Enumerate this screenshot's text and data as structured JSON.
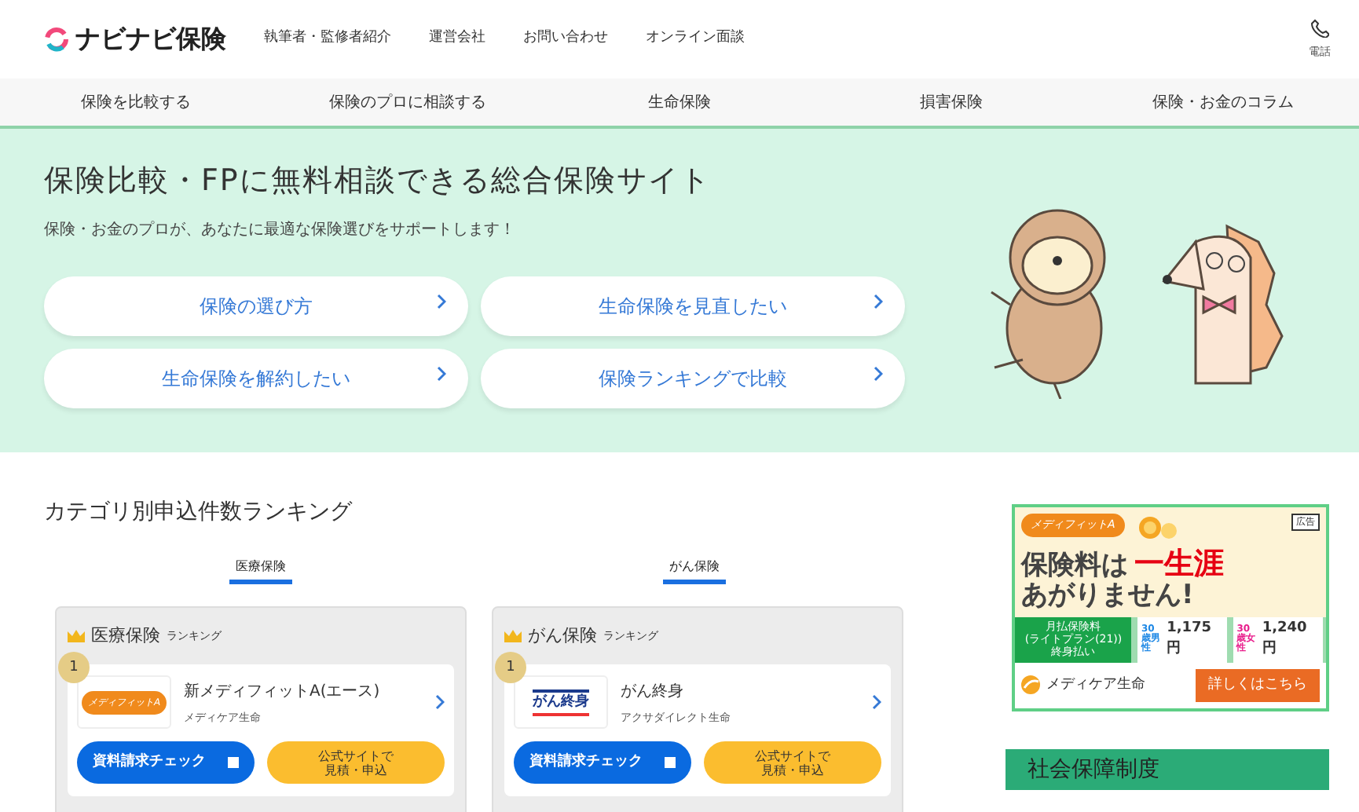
{
  "header": {
    "logo": "ナビナビ保険",
    "links": [
      "執筆者・監修者紹介",
      "運営会社",
      "お問い合わせ",
      "オンライン面談"
    ],
    "phone_label": "電話"
  },
  "nav": [
    "保険を比較する",
    "保険のプロに相談する",
    "生命保険",
    "損害保険",
    "保険・お金のコラム"
  ],
  "hero": {
    "title": "保険比較・FPに無料相談できる総合保険サイト",
    "subtitle": "保険・お金のプロが、あなたに最適な保険選びをサポートします！",
    "buttons": [
      "保険の選び方",
      "生命保険を見直したい",
      "生命保険を解約したい",
      "保険ランキングで比較"
    ]
  },
  "ranking": {
    "title": "カテゴリ別申込件数ランキング",
    "tabs": [
      {
        "label": "医療保険",
        "selected": true
      },
      {
        "label": "がん保険",
        "selected": true
      }
    ],
    "cards": [
      {
        "category": "医療保険",
        "suffix": "ランキング",
        "rank": "1",
        "kind": "medifit",
        "logo_text": "メディフィットA",
        "product": "新メディフィットA(エース)",
        "company": "メディケア生命",
        "request_button": "資料請求チェック",
        "checked": false,
        "apply_button": "公式サイトで見積・申込"
      },
      {
        "category": "がん保険",
        "suffix": "ランキング",
        "rank": "1",
        "kind": "axa",
        "logo_text": "がん終身",
        "product": "がん終身",
        "company": "アクサダイレクト生命",
        "request_button": "資料請求チェック",
        "checked": false,
        "apply_button": "公式サイトで見積・申込"
      }
    ]
  },
  "ad": {
    "tag": "広告",
    "logo_text": "メディフィットA",
    "headline": "保険料は",
    "highlight": "一生涯",
    "headline2": "あがりません!",
    "price_label": [
      "月払保険料",
      "(ライトプラン(21))",
      "終身払い"
    ],
    "prices": [
      {
        "who": "30歳男性",
        "price": "1,175円",
        "color": "#1e88e5"
      },
      {
        "who": "30歳女性",
        "price": "1,240円",
        "color": "#e91e8c"
      }
    ],
    "company": "メディケア生命",
    "cta": "詳しくはこちら"
  },
  "side_banner": "社会保障制度"
}
